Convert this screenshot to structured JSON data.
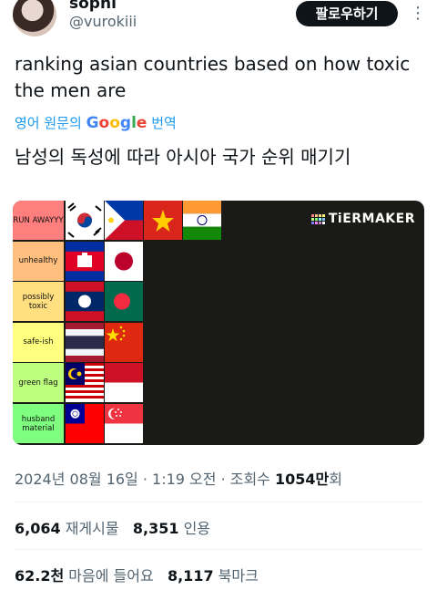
{
  "profile": {
    "display_name": "sophi",
    "handle": "@vurokiii",
    "follow_label": "팔로우하기",
    "more_icon": "more-icon"
  },
  "tweet": {
    "text": "ranking asian countries based on how toxic the men are",
    "translate_prefix": "영어 원문의",
    "translate_brand": "Google",
    "translate_suffix": "번역",
    "translated_text": "남성의 독성에 따라 아시아 국가 순위 매기기"
  },
  "tierlist": {
    "logo_text": "TiERMAKER",
    "tiers": [
      {
        "label": "RUN AWAYYY",
        "color": "#ff7f7f",
        "flags": [
          "South Korea",
          "Philippines",
          "Vietnam",
          "India"
        ]
      },
      {
        "label": "unhealthy",
        "color": "#ffbf7f",
        "flags": [
          "Cambodia",
          "Japan"
        ]
      },
      {
        "label": "possibly toxic",
        "color": "#ffdf7f",
        "flags": [
          "Laos",
          "Bangladesh"
        ]
      },
      {
        "label": "safe-ish",
        "color": "#ffff7f",
        "flags": [
          "Thailand",
          "China"
        ]
      },
      {
        "label": "green flag",
        "color": "#bfff7f",
        "flags": [
          "Malaysia",
          "Indonesia"
        ]
      },
      {
        "label": "husband material",
        "color": "#7fff7f",
        "flags": [
          "Taiwan",
          "Singapore"
        ]
      }
    ]
  },
  "meta": {
    "timestamp": "2024년 08월 16일 · 1:19 오전 · 조회수",
    "views": "1054만",
    "views_suffix": "회"
  },
  "stats": {
    "reposts_num": "6,064",
    "reposts_label": "재게시물",
    "quotes_num": "8,351",
    "quotes_label": "인용",
    "likes_num": "62.2천",
    "likes_label": "마음에 들어요",
    "bookmarks_num": "8,117",
    "bookmarks_label": "북마크"
  }
}
